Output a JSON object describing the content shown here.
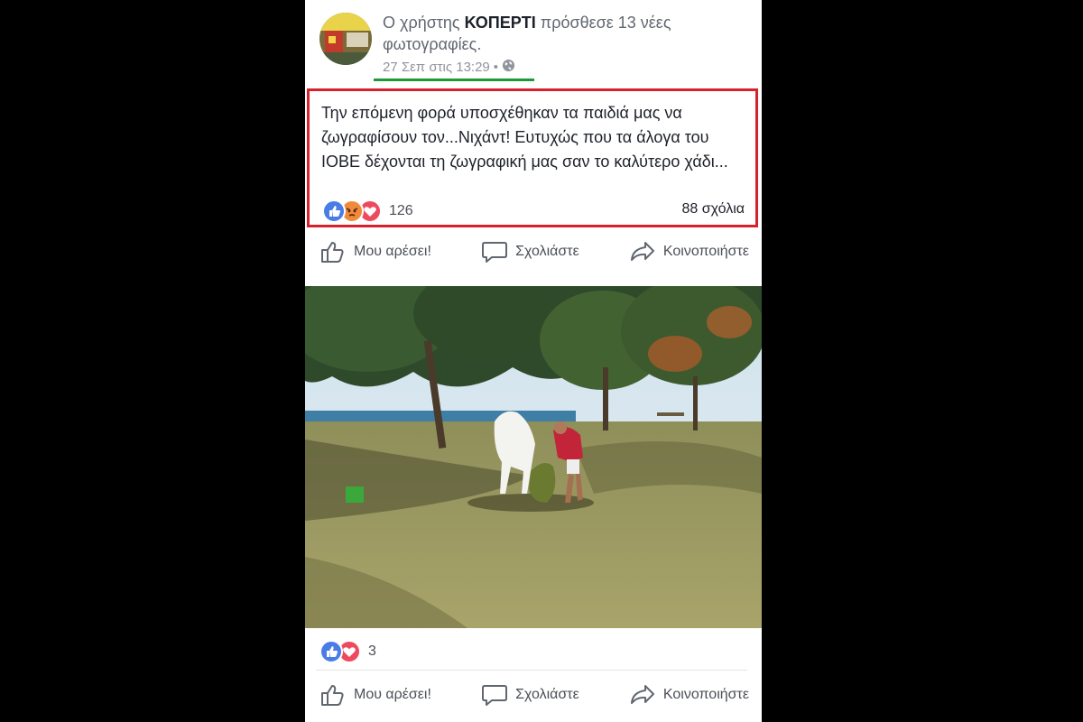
{
  "post": {
    "headline_prefix": "Ο χρήστης ",
    "author": "ΚΟΠΕΡΤΙ",
    "headline_suffix": " πρόσθεσε 13 νέες φωτογραφίες.",
    "timestamp": "27 Σεπ στις 13:29",
    "timestamp_sep": "•",
    "audience_icon": "globe-icon",
    "caption": "Την επόμενη φορά υποσχέθηκαν τα παιδιά μας να ζωγραφίσουν τον...Νιχάντ! Ευτυχώς που τα άλογα του ΙΟΒΕ δέχονται τη ζωγραφική μας σαν το καλύτερο χάδι...",
    "reaction_count": "126",
    "comments": "88 σχόλια",
    "accent_highlight": "#d7222c",
    "accent_underline": "#1d9a36"
  },
  "actions": {
    "like": "Μου αρέσει!",
    "comment": "Σχολιάστε",
    "share": "Κοινοποιήστε"
  },
  "photo": {
    "reaction_count": "3"
  },
  "colors": {
    "like_blue": "#4a7ce6",
    "love_red": "#ed4a5e",
    "angry_orange": "#f08a3a"
  }
}
